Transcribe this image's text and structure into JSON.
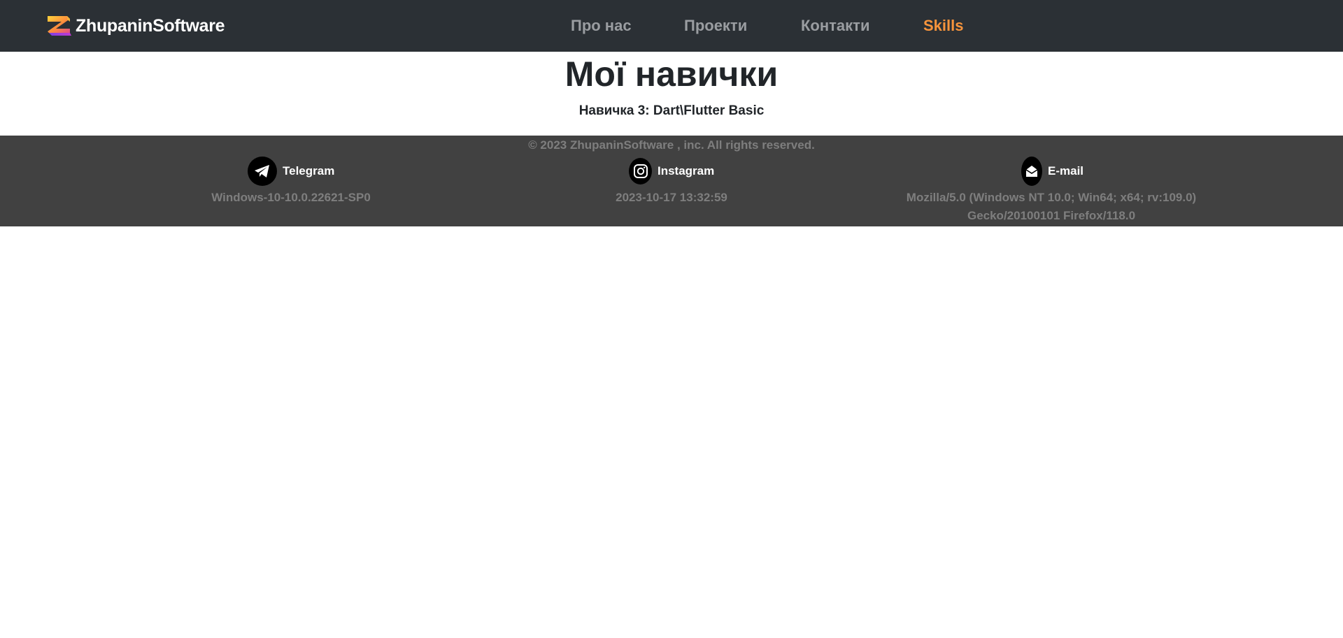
{
  "header": {
    "brand": "ZhupaninSoftware",
    "logo_icon": "zs-logo-icon",
    "nav": [
      {
        "label": "Про нас",
        "active": false
      },
      {
        "label": "Проекти",
        "active": false
      },
      {
        "label": "Контакти",
        "active": false
      },
      {
        "label": "Skills",
        "active": true
      }
    ]
  },
  "main": {
    "title": "Мої навички",
    "skill": "Навичка 3: Dart\\Flutter Basic"
  },
  "footer": {
    "copyright": "© 2023 ZhupaninSoftware , inc. All rights reserved.",
    "social": [
      {
        "label": "Telegram",
        "icon": "telegram-icon"
      },
      {
        "label": "Instagram",
        "icon": "instagram-icon"
      },
      {
        "label": "E-mail",
        "icon": "email-icon"
      }
    ],
    "info": {
      "os": "Windows-10-10.0.22621-SP0",
      "datetime": "2023-10-17 13:32:59",
      "user_agent_line1": "Mozilla/5.0 (Windows NT 10.0; Win64; x64; rv:109.0)",
      "user_agent_line2": "Gecko/20100101 Firefox/118.0"
    }
  },
  "colors": {
    "navbar_bg": "#2b3035",
    "nav_link": "#9a9da1",
    "nav_active": "#f7943c",
    "footer_bg": "#414141",
    "footer_muted": "#7e7e7e",
    "text_dark": "#212529"
  }
}
